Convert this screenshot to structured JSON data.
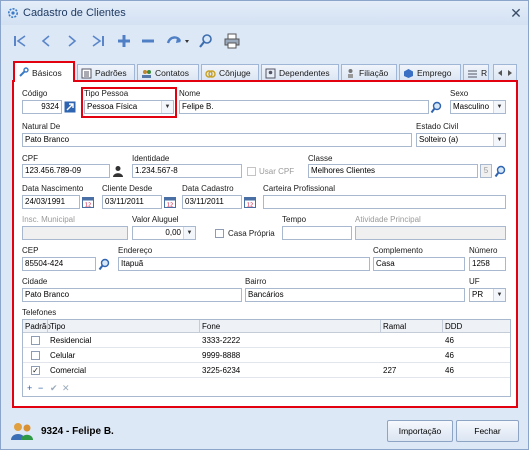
{
  "window": {
    "title": "Cadastro de Clientes",
    "close_glyph": "✕"
  },
  "toolbar": {
    "buttons": [
      "first-record-icon",
      "previous-record-icon",
      "next-record-icon",
      "last-record-icon",
      "add-icon",
      "remove-icon",
      "undo-icon",
      "search-icon",
      "print-icon"
    ]
  },
  "tabs": [
    "Básicos",
    "Padrões",
    "Contatos",
    "Cônjuge",
    "Dependentes",
    "Filiação",
    "Emprego",
    "R"
  ],
  "form": {
    "codigo": {
      "label": "Código",
      "value": "9324"
    },
    "tipo_pessoa": {
      "label": "Tipo Pessoa",
      "value": "Pessoa Física"
    },
    "nome": {
      "label": "Nome",
      "value": "Felipe B."
    },
    "sexo": {
      "label": "Sexo",
      "value": "Masculino"
    },
    "natural_de": {
      "label": "Natural De",
      "value": "Pato Branco"
    },
    "estado_civil": {
      "label": "Estado Civil",
      "value": "Solteiro (a)"
    },
    "cpf": {
      "label": "CPF",
      "value": "123.456.789-09"
    },
    "identidade": {
      "label": "Identidade",
      "value": "1.234.567-8"
    },
    "usar_cpf": {
      "label": "Usar CPF"
    },
    "classe": {
      "label": "Classe",
      "value": "Melhores Clientes",
      "code": "5"
    },
    "data_nascimento": {
      "label": "Data Nascimento",
      "value": "24/03/1991"
    },
    "cliente_desde": {
      "label": "Cliente Desde",
      "value": "03/11/2011"
    },
    "data_cadastro": {
      "label": "Data Cadastro",
      "value": "03/11/2011"
    },
    "carteira_profissional": {
      "label": "Carteira Profissional",
      "value": ""
    },
    "insc_municipal": {
      "label": "Insc. Municipal",
      "value": ""
    },
    "valor_aluguel": {
      "label": "Valor Aluguel",
      "value": "0,00"
    },
    "casa_propria": {
      "label": "Casa Própria"
    },
    "tempo": {
      "label": "Tempo",
      "value": ""
    },
    "atividade_principal": {
      "label": "Atividade Principal",
      "value": ""
    },
    "cep": {
      "label": "CEP",
      "value": "85504-424"
    },
    "endereco": {
      "label": "Endereço",
      "value": "Itapuã"
    },
    "complemento": {
      "label": "Complemento",
      "value": "Casa"
    },
    "numero": {
      "label": "Número",
      "value": "1258"
    },
    "cidade": {
      "label": "Cidade",
      "value": "Pato Branco"
    },
    "bairro": {
      "label": "Bairro",
      "value": "Bancários"
    },
    "uf": {
      "label": "UF",
      "value": "PR"
    }
  },
  "telefones": {
    "label": "Telefones",
    "columns": [
      "Padrão",
      "Tipo",
      "Fone",
      "Ramal",
      "DDD"
    ],
    "rows": [
      {
        "padrao": false,
        "tipo": "Residencial",
        "fone": "3333-2222",
        "ramal": "",
        "ddd": "46"
      },
      {
        "padrao": false,
        "tipo": "Celular",
        "fone": "9999-8888",
        "ramal": "",
        "ddd": "46"
      },
      {
        "padrao": true,
        "tipo": "Comercial",
        "fone": "3225-6234",
        "ramal": "227",
        "ddd": "46"
      }
    ],
    "nav": {
      "add": "+",
      "remove": "−",
      "post": "✔",
      "cancel": "✕"
    }
  },
  "footer": {
    "code": "9324",
    "separator": " - ",
    "name": "Felipe B.",
    "import_label": "Importação",
    "close_label": "Fechar"
  },
  "colors": {
    "highlight": "#e3000f",
    "accent": "#2b5ea0"
  }
}
